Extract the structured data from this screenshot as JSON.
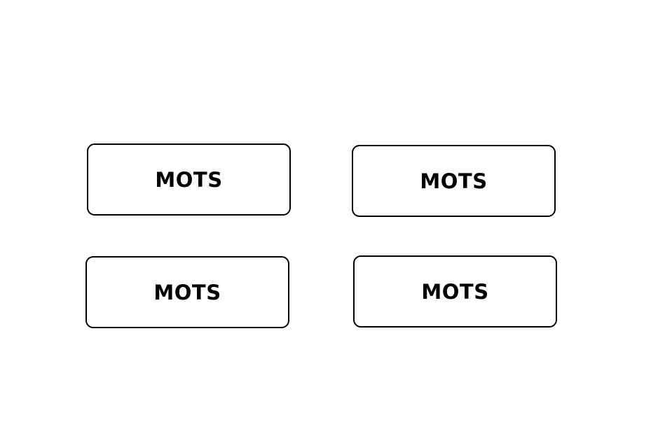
{
  "boxes": [
    {
      "label": "MOTS"
    },
    {
      "label": "MOTS"
    },
    {
      "label": "MOTS"
    },
    {
      "label": "MOTS"
    }
  ],
  "colors": {
    "background": "#ffffff",
    "border": "#000000",
    "text": "#000000"
  }
}
